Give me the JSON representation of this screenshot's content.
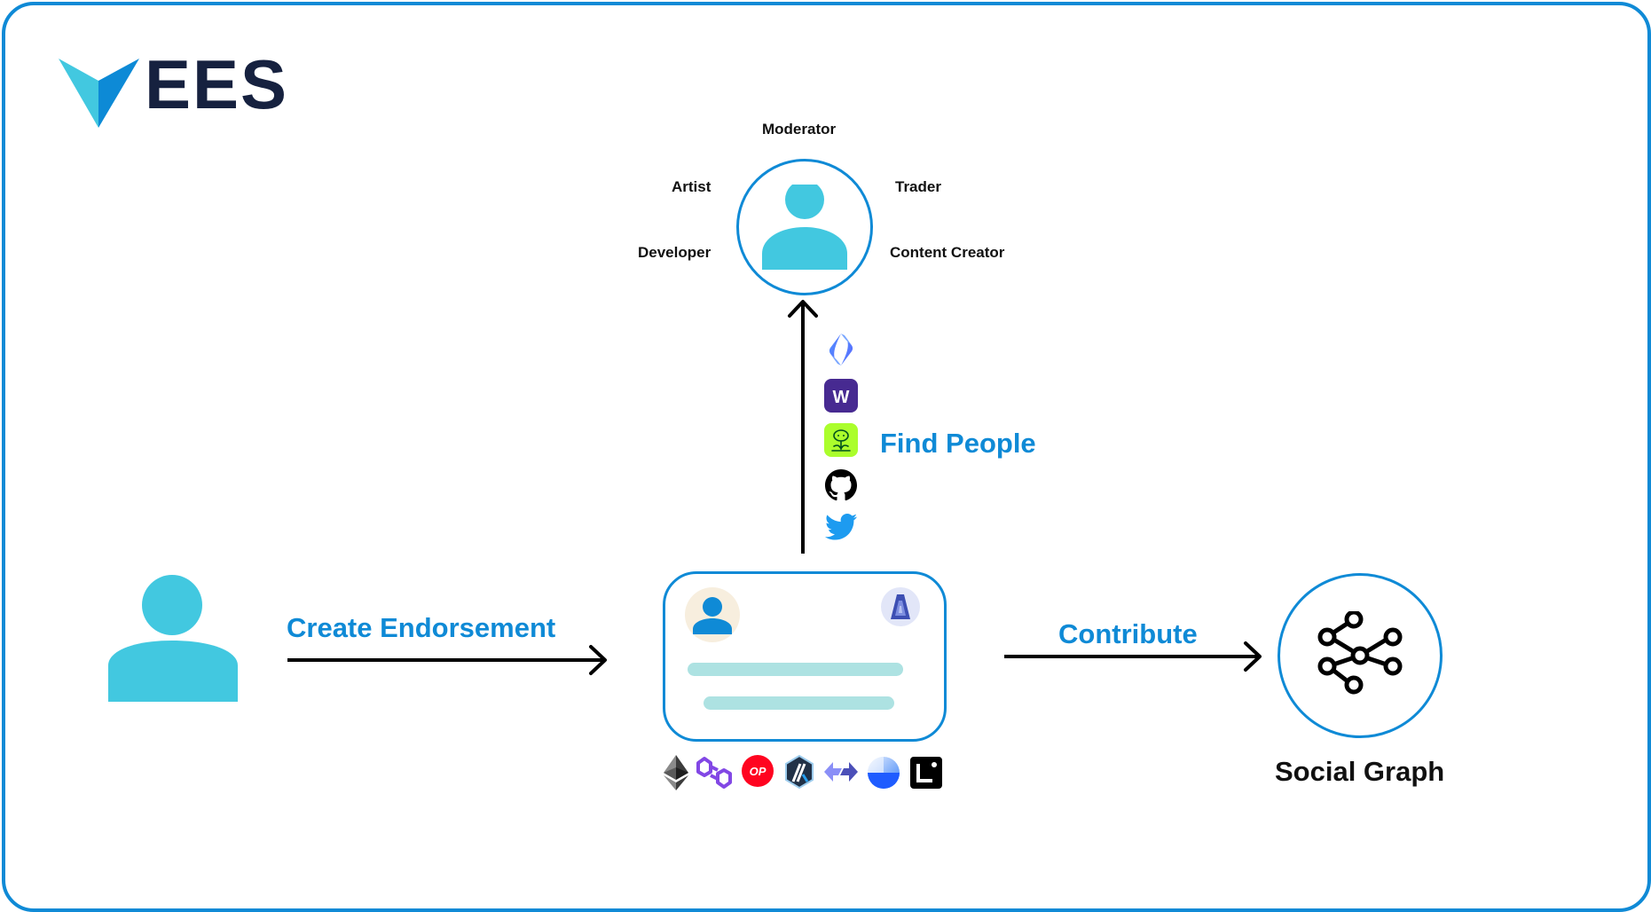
{
  "logo": {
    "text": "EES",
    "colors": {
      "wing_light": "#42c8e0",
      "wing_dark": "#0d8ad6",
      "text": "#16213f"
    }
  },
  "profile": {
    "icon": "user-icon",
    "roles": {
      "top": "Moderator",
      "upper_left": "Artist",
      "upper_right": "Trader",
      "lower_left": "Developer",
      "lower_right": "Content Creator"
    }
  },
  "flow": {
    "find_people_label": "Find People",
    "create_endorsement_label": "Create Endorsement",
    "contribute_label": "Contribute",
    "social_graph_label": "Social Graph"
  },
  "identity_sources": [
    {
      "name": "ens-icon"
    },
    {
      "name": "warpcast-icon",
      "glyph": "W"
    },
    {
      "name": "lens-icon"
    },
    {
      "name": "github-icon"
    },
    {
      "name": "twitter-icon"
    }
  ],
  "chains": [
    {
      "name": "ethereum-icon"
    },
    {
      "name": "polygon-icon"
    },
    {
      "name": "optimism-icon",
      "glyph": "OP"
    },
    {
      "name": "arbitrum-icon"
    },
    {
      "name": "bridge-icon"
    },
    {
      "name": "base-icon"
    },
    {
      "name": "linea-icon"
    }
  ],
  "colors": {
    "accent": "#0f8ad6",
    "person": "#42c8e0",
    "card_line": "#ade2e2",
    "arrow": "#000000"
  }
}
